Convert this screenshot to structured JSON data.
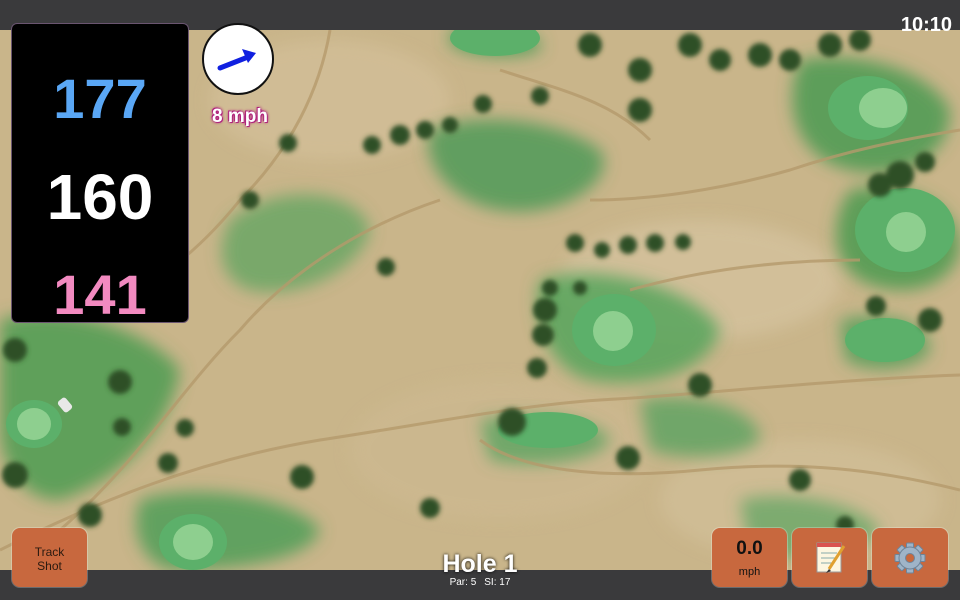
{
  "status_bar": {
    "time": "10:10"
  },
  "distances": {
    "back": "177",
    "middle": "160",
    "front": "141"
  },
  "wind": {
    "speed_text": "8 mph",
    "direction_icon": "arrow-icon",
    "arrow_color": "#1020e0"
  },
  "hole": {
    "title": "Hole 1",
    "par": "Par: 5",
    "stroke_index": "SI: 17"
  },
  "buttons": {
    "track_shot": {
      "line1": "Track",
      "line2": "Shot"
    },
    "speed": {
      "value": "0.0",
      "unit": "mph"
    },
    "notes": {
      "icon": "notepad-icon"
    },
    "settings": {
      "icon": "gear-icon"
    }
  },
  "colors": {
    "back_distance": "#5aa7f5",
    "middle_distance": "#ffffff",
    "front_distance": "#f28ac0",
    "button": "#c8683e",
    "bar": "#3a3a3c"
  }
}
